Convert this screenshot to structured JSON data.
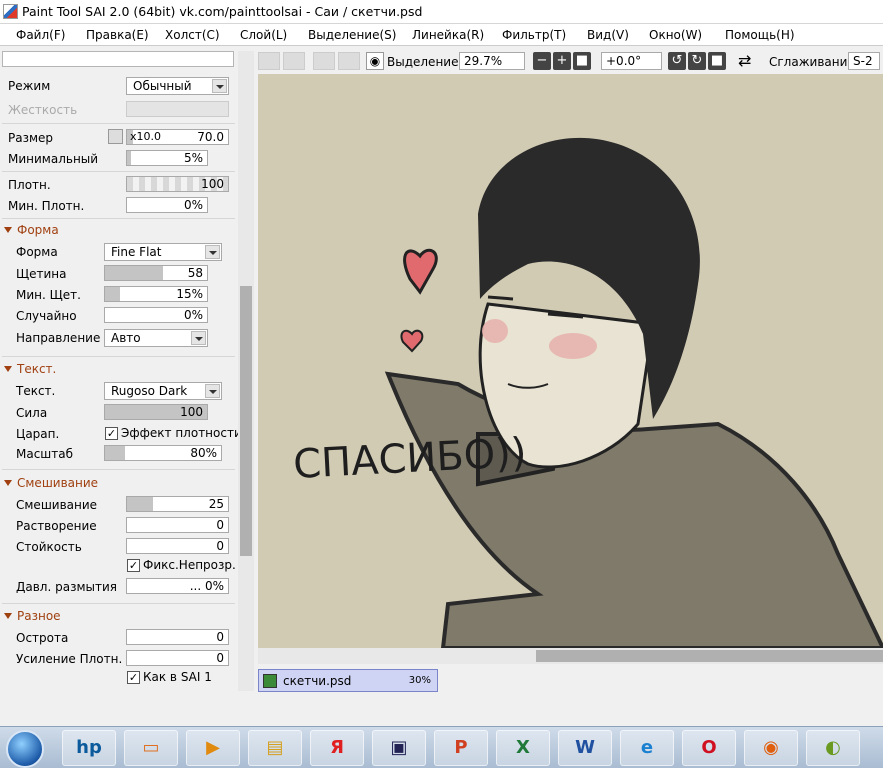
{
  "window": {
    "title": "Paint Tool SAI 2.0 (64bit) vk.com/painttoolsai - Саи / скетчи.psd"
  },
  "menu": [
    "Файл(F)",
    "Правка(E)",
    "Холст(C)",
    "Слой(L)",
    "Выделение(S)",
    "Линейка(R)",
    "Фильтр(T)",
    "Вид(V)",
    "Окно(W)",
    "Помощь(H)"
  ],
  "brush": {
    "mode_label": "Режим",
    "mode_value": "Обычный",
    "hardness_label": "Жесткость",
    "size_label": "Размер",
    "size_mult": "x10.0",
    "size_value": "70.0",
    "min_size_label": "Минимальный",
    "min_size_value": "5%",
    "density_label": "Плотн.",
    "density_value": "100",
    "min_density_label": "Мин. Плотн.",
    "min_density_value": "0%"
  },
  "shape": {
    "title": "Форма",
    "shape_label": "Форма",
    "shape_value": "Fine Flat",
    "bristle_label": "Щетина",
    "bristle_value": "58",
    "min_bristle_label": "Мин. Щет.",
    "min_bristle_value": "15%",
    "random_label": "Случайно",
    "random_value": "0%",
    "direction_label": "Направление",
    "direction_value": "Авто"
  },
  "texture": {
    "title": "Текст.",
    "texture_label": "Текст.",
    "texture_value": "Rugoso Dark",
    "strength_label": "Сила",
    "strength_value": "100",
    "scratch_label": "Царап.",
    "density_effect_label": "Эффект плотности",
    "scale_label": "Масштаб",
    "scale_value": "80%"
  },
  "blending": {
    "title": "Смешивание",
    "blend_label": "Смешивание",
    "blend_value": "25",
    "dilution_label": "Растворение",
    "dilution_value": "0",
    "persistence_label": "Стойкость",
    "persistence_value": "0",
    "fix_opacity_label": "Фикс.Непрозр.",
    "blur_label": "Давл. размытия",
    "blur_value": "... 0%"
  },
  "misc": {
    "title": "Разное",
    "sharpness_label": "Острота",
    "sharpness_value": "0",
    "density_boost_label": "Усиление Плотн.",
    "density_boost_value": "0",
    "sai1_label": "Как в SAI 1"
  },
  "toolbar": {
    "selection_label": "Выделение",
    "zoom": "29.7%",
    "rotation": "+0.0°",
    "smoothing_label": "Сглаживание",
    "smoothing_value": "S-2"
  },
  "canvas": {
    "sketch_text": "СПАСИБО))"
  },
  "document_tab": {
    "name": "скетчи.psd",
    "zoom": "30%"
  },
  "colors": {
    "canvas_bg": "#d2cbb4",
    "section_title": "#a04010",
    "tab_bg": "#cfd4f5"
  }
}
